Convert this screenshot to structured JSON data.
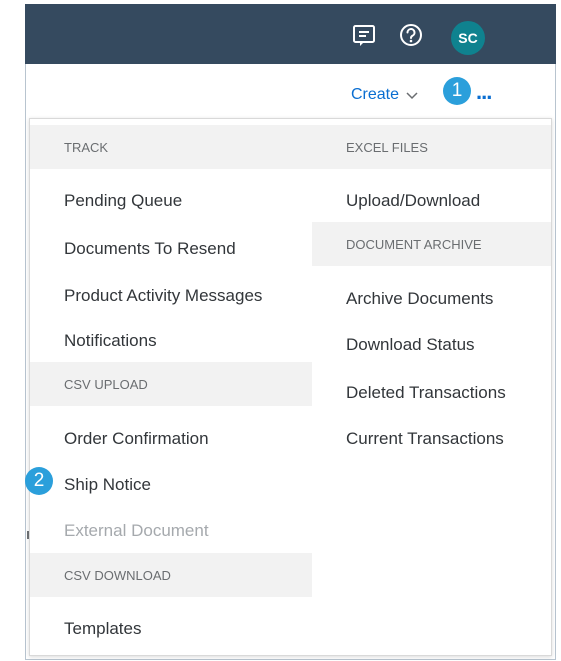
{
  "header": {
    "notifications_icon": "notifications-icon",
    "help_icon": "help-icon",
    "avatar_initials": "SC",
    "avatar_color": "#0f828f",
    "bar_color": "#354a5f"
  },
  "toolbar": {
    "create_label": "Create",
    "more_label": "..."
  },
  "callouts": [
    "1",
    "2"
  ],
  "menu": {
    "left": {
      "sections": [
        {
          "title": "TRACK",
          "items": [
            "Pending Queue",
            "Documents To Resend",
            "Product Activity Messages",
            "Notifications"
          ]
        },
        {
          "title": "CSV UPLOAD",
          "items": [
            "Order Confirmation",
            "Ship Notice",
            "External Document"
          ]
        },
        {
          "title": "CSV DOWNLOAD",
          "items": [
            "Templates"
          ]
        }
      ]
    },
    "right": {
      "sections": [
        {
          "title": "EXCEL FILES",
          "items": [
            "Upload/Download"
          ]
        },
        {
          "title": "DOCUMENT ARCHIVE",
          "items": [
            "Archive Documents",
            "Download Status",
            "Deleted Transactions",
            "Current Transactions"
          ]
        }
      ]
    },
    "disabled_item": "External Document"
  }
}
